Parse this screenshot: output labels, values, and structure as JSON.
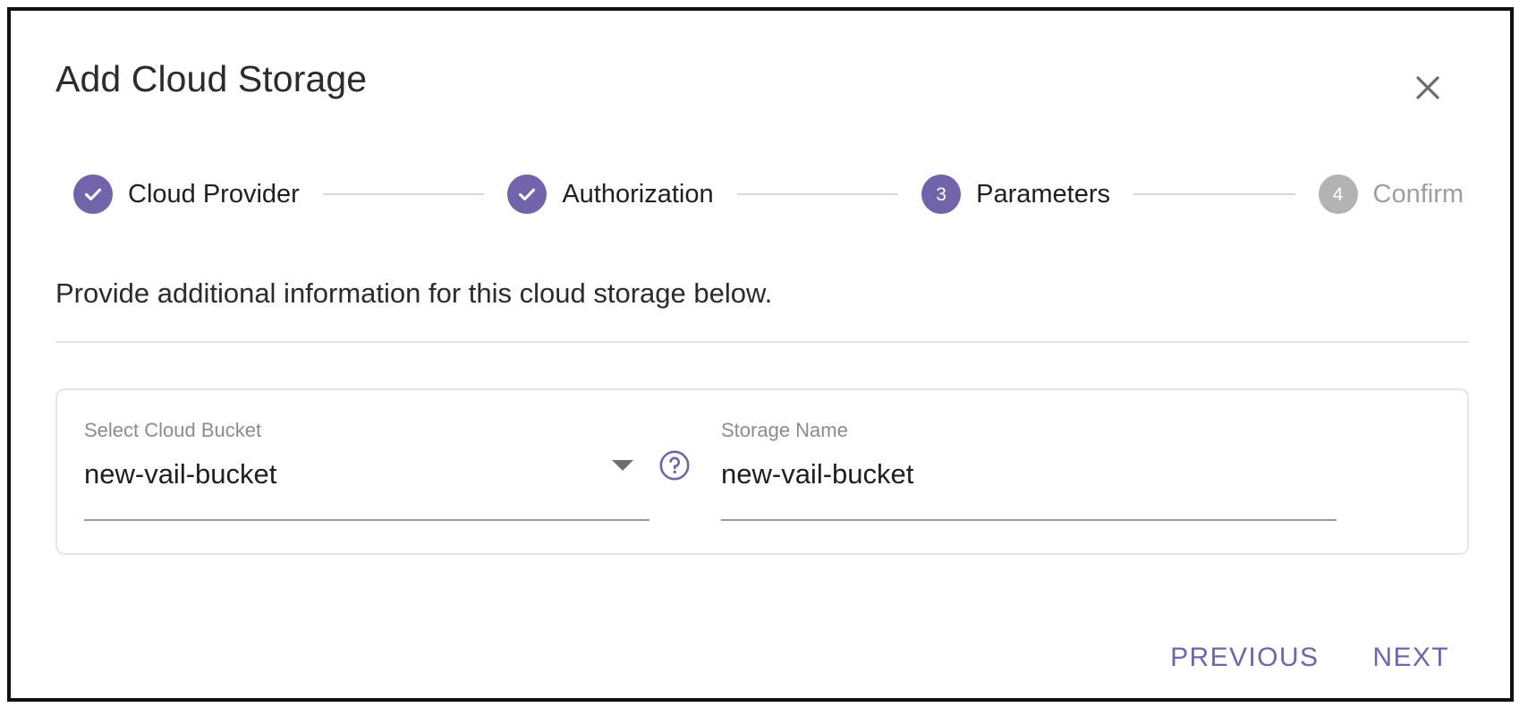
{
  "dialog": {
    "title": "Add Cloud Storage",
    "close_label": "close-icon",
    "description": "Provide additional information for this cloud storage below."
  },
  "stepper": {
    "steps": [
      {
        "label": "Cloud Provider",
        "state": "done",
        "marker": "check"
      },
      {
        "label": "Authorization",
        "state": "done",
        "marker": "check"
      },
      {
        "label": "Parameters",
        "state": "active",
        "marker": "3"
      },
      {
        "label": "Confirm",
        "state": "inactive",
        "marker": "4"
      }
    ]
  },
  "form": {
    "bucket": {
      "label": "Select Cloud Bucket",
      "value": "new-vail-bucket",
      "help_icon": "help-circle-icon",
      "caret_icon": "chevron-down-icon"
    },
    "storage_name": {
      "label": "Storage Name",
      "value": "new-vail-bucket"
    }
  },
  "footer": {
    "previous_label": "PREVIOUS",
    "next_label": "NEXT"
  },
  "colors": {
    "accent": "#7164ab",
    "inactive": "#b3b3b3",
    "text": "#1f1f1f",
    "muted_text": "#8c8c8c",
    "underline": "#9b9b9b",
    "divider": "#e4e4e4"
  }
}
